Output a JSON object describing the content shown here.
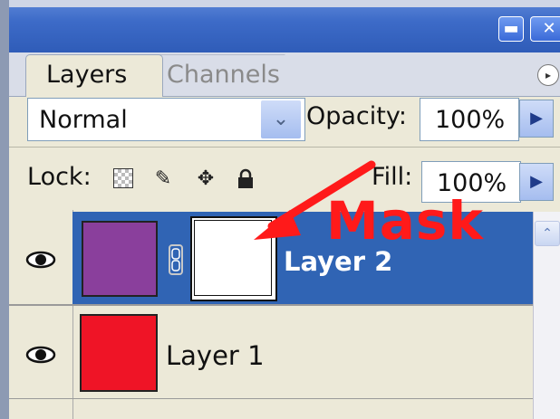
{
  "window": {
    "minimize_icon": "minimize-icon",
    "minimize_glyph": "▬",
    "close_icon": "close-icon",
    "close_glyph": "✕"
  },
  "tabs": [
    {
      "label": "Layers",
      "active": true
    },
    {
      "label": "Channels",
      "active": false
    }
  ],
  "palette_menu_glyph": "▸",
  "blend_mode": {
    "value": "Normal",
    "arrow": "⌄"
  },
  "opacity": {
    "label": "Opacity:",
    "value": "100%"
  },
  "fill": {
    "label": "Fill:",
    "value": "100%"
  },
  "lock": {
    "label": "Lock:",
    "icons": [
      "transparency-lock-icon",
      "brush-lock-icon",
      "move-lock-icon",
      "padlock-icon"
    ],
    "glyphs": [
      "",
      "✎",
      "✥",
      "🔒"
    ]
  },
  "layers": [
    {
      "name": "Layer 2",
      "thumb_color": "#8a3f9c",
      "has_mask": true,
      "selected": true,
      "visible_glyph": "👁"
    },
    {
      "name": "Layer 1",
      "thumb_color": "#ef1426",
      "has_mask": false,
      "selected": false,
      "visible_glyph": "👁"
    }
  ],
  "annotation": {
    "text": "Mask",
    "color": "#ff1a1a"
  },
  "colors": {
    "selection": "#3064b4",
    "titlebar": "#3d6bc8",
    "panel": "#ece9d8"
  }
}
